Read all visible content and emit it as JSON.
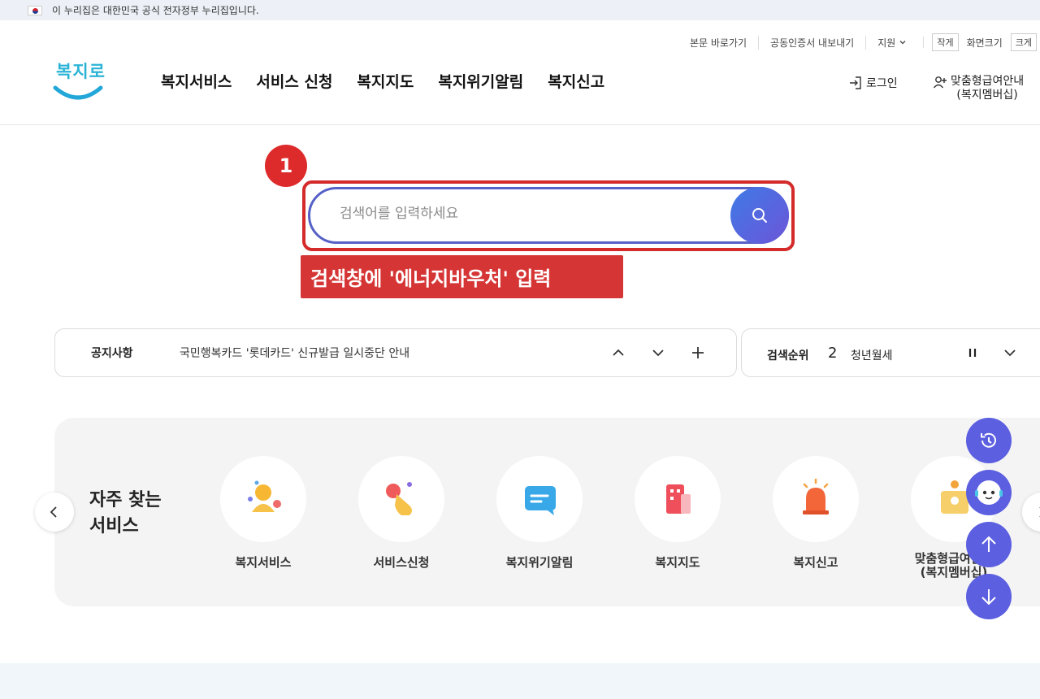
{
  "gov_banner": {
    "text": "이 누리집은 대한민국 공식 전자정부 누리집입니다."
  },
  "utility": {
    "skip": "본문 바로가기",
    "cert": "공동인증서 내보내기",
    "support": "지원",
    "small": "작게",
    "screen_size": "화면크기",
    "large": "크게"
  },
  "logo": {
    "text": "복지로"
  },
  "gnb": [
    "복지서비스",
    "서비스 신청",
    "복지지도",
    "복지위기알림",
    "복지신고"
  ],
  "header_right": {
    "login": "로그인",
    "member_line1": "맞춤형급여안내",
    "member_line2": "(복지멤버십)"
  },
  "guide": {
    "step": "1",
    "caption": "검색창에 '에너지바우처' 입력"
  },
  "search": {
    "placeholder": "검색어를 입력하세요"
  },
  "notice": {
    "label": "공지사항",
    "text": "국민행복카드 '롯데카드' 신규발급 일시중단 안내"
  },
  "rank": {
    "label": "검색순위",
    "number": "2",
    "word": "청년월세"
  },
  "favorites": {
    "title_line1": "자주 찾는",
    "title_line2": "서비스",
    "items": [
      {
        "label": "복지서비스",
        "icon": "people-icon"
      },
      {
        "label": "서비스신청",
        "icon": "hand-pointer-icon"
      },
      {
        "label": "복지위기알림",
        "icon": "message-icon"
      },
      {
        "label": "복지지도",
        "icon": "building-icon"
      },
      {
        "label": "복지신고",
        "icon": "siren-icon"
      },
      {
        "label_line1": "맞춤형급여안내",
        "label_line2": "(복지멤버십)",
        "icon": "member-card-icon"
      }
    ]
  },
  "colors": {
    "accent": "#5661c7",
    "guide_red": "#d63535",
    "float_button": "#5b5fe0"
  }
}
